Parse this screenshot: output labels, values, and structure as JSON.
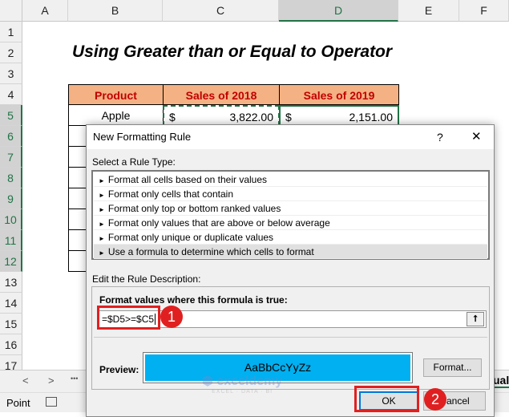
{
  "columns": [
    "A",
    "B",
    "C",
    "D",
    "E",
    "F"
  ],
  "rows": [
    "1",
    "2",
    "3",
    "4",
    "5",
    "6",
    "7",
    "8",
    "9",
    "10",
    "11",
    "12",
    "13",
    "14",
    "15",
    "16",
    "17"
  ],
  "sheet_title": "Using Greater than or Equal to Operator",
  "table": {
    "headers": [
      "Product",
      "Sales of 2018",
      "Sales of 2019"
    ],
    "row5": {
      "product": "Apple",
      "c_sym": "$",
      "c_val": "3,822.00",
      "d_sym": "$",
      "d_val": "2,151.00"
    }
  },
  "dialog": {
    "title": "New Formatting Rule",
    "help": "?",
    "close": "✕",
    "select_label": "Select a Rule Type:",
    "rule_types": [
      "Format all cells based on their values",
      "Format only cells that contain",
      "Format only top or bottom ranked values",
      "Format only values that are above or below average",
      "Format only unique or duplicate values",
      "Use a formula to determine which cells to format"
    ],
    "rule_bullet": "►",
    "edit_label": "Edit the Rule Description:",
    "formula_label": "Format values where this formula is true:",
    "formula_value": "=$D5>=$C5",
    "preview_label": "Preview:",
    "preview_text": "AaBbCcYyZz",
    "preview_color": "#00b0f0",
    "format_btn": "Format...",
    "ok_btn": "OK",
    "cancel_btn": "Cancel"
  },
  "annotations": [
    "1",
    "2"
  ],
  "tabs": {
    "prev": "<",
    "next": ">",
    "more": "•••",
    "partial_tab": "ual"
  },
  "status": {
    "mode": "Point"
  },
  "watermark": {
    "name": "exceldemy",
    "tag": "EXCEL · DATA · BI"
  }
}
